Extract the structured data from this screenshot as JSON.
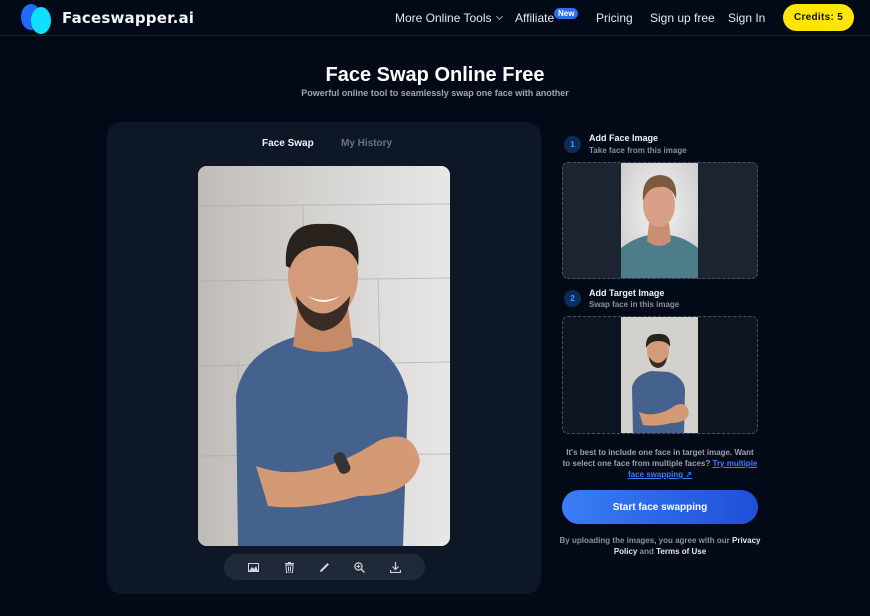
{
  "header": {
    "brand": "Faceswapper.ai",
    "nav": {
      "more_tools": "More Online Tools",
      "affiliate": "Affiliate",
      "affiliate_badge": "New",
      "pricing": "Pricing",
      "signup": "Sign up free",
      "signin": "Sign In"
    },
    "credits": "Credits: 5"
  },
  "hero": {
    "title": "Face Swap Online Free",
    "subtitle": "Powerful online tool to seamlessly swap one face with another"
  },
  "workspace": {
    "tabs": [
      {
        "label": "Face Swap",
        "active": true
      },
      {
        "label": "My History",
        "active": false
      }
    ],
    "toolbar": [
      "image-icon",
      "trash-icon",
      "pencil-icon",
      "zoom-in-icon",
      "download-icon"
    ]
  },
  "steps": [
    {
      "number": "1",
      "title": "Add Face Image",
      "subtitle": "Take face from this image"
    },
    {
      "number": "2",
      "title": "Add Target Image",
      "subtitle": "Swap face in this image"
    }
  ],
  "hint": {
    "text": "It's best to include one face in target image. Want to select one face from multiple faces?",
    "link": "Try multiple face swapping ↗"
  },
  "start_button": "Start face swapping",
  "terms": {
    "prefix": "By uploading the images, you agree with our",
    "privacy": "Privacy Policy",
    "and": "and",
    "tou": "Terms of Use"
  },
  "colors": {
    "background": "#020a18",
    "panel": "#0e1726",
    "accent": "#3a7ef5",
    "credits": "#ffe600",
    "badge": "#2f6dea"
  }
}
